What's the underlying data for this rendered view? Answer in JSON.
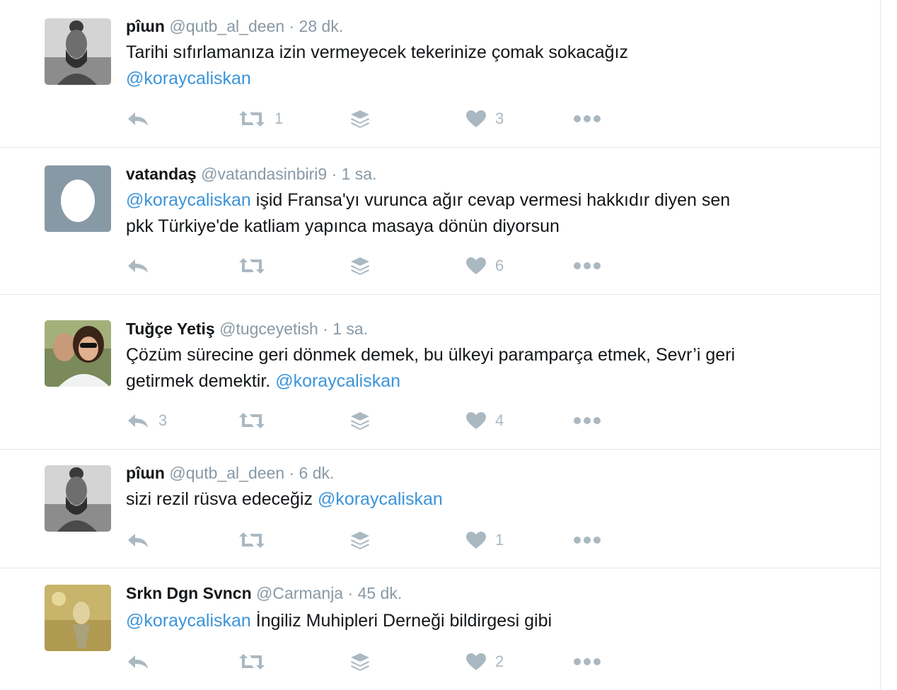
{
  "colors": {
    "name": "#14171a",
    "muted": "#8899a6",
    "link": "#3b94d9",
    "icon": "#aab8c2",
    "divider": "#e1e8ed"
  },
  "tweets": [
    {
      "name": "pîɯn",
      "handle": "@qutb_al_deen",
      "time": "· 28 dk.",
      "text1": "Tarihi sıfırlamanıza izin vermeyecek tekerinize çomak sokacağız",
      "mention1": "@koraycaliskan",
      "reply_count": "",
      "retweet_count": "1",
      "like_count": "3",
      "avatar": "man-bun-avatar"
    },
    {
      "name": "vatandaş",
      "handle": "@vatandasinbiri9",
      "time": "· 1 sa.",
      "mention1": "@koraycaliskan",
      "text1": " işid Fransa'yı vurunca ağır cevap vermesi hakkıdır diyen sen",
      "text2": "pkk Türkiye'de katliam yapınca masaya dönün diyorsun",
      "reply_count": "",
      "retweet_count": "",
      "like_count": "6",
      "avatar": "egg-avatar"
    },
    {
      "name": "Tuğçe Yetiş",
      "handle": "@tugceyetish",
      "time": "· 1 sa.",
      "text1": "Çözüm sürecine geri dönmek demek, bu ülkeyi paramparça etmek, Sevr’i geri",
      "text2": "getirmek demektir. ",
      "mention1": "@koraycaliskan",
      "reply_count": "3",
      "retweet_count": "",
      "like_count": "4",
      "avatar": "woman-sunglasses-avatar"
    },
    {
      "name": "pîɯn",
      "handle": "@qutb_al_deen",
      "time": "· 6 dk.",
      "text1": "sizi rezil rüsva edeceğiz ",
      "mention1": "@koraycaliskan",
      "reply_count": "",
      "retweet_count": "",
      "like_count": "1",
      "avatar": "man-bun-avatar"
    },
    {
      "name": "Srkn Dgn Svncn",
      "handle": "@Carmanja",
      "time": "· 45 dk.",
      "mention1": "@koraycaliskan",
      "text1": " İngiliz Muhipleri Derneği bildirgesi gibi",
      "reply_count": "",
      "retweet_count": "",
      "like_count": "2",
      "avatar": "yellow-photo-avatar"
    }
  ]
}
